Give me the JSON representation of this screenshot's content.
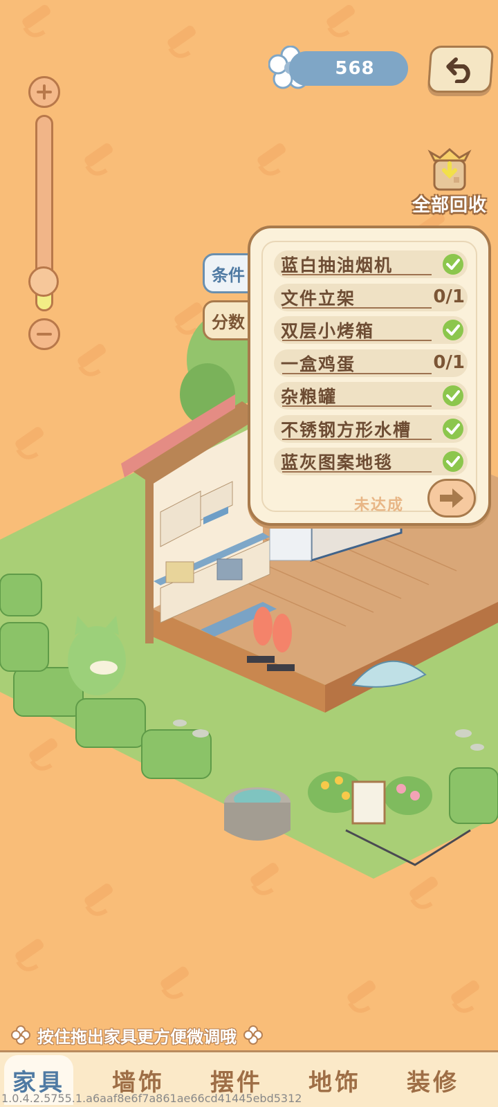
{
  "currency": {
    "icon": "flower-icon",
    "amount": "568"
  },
  "recycle_all": {
    "label": "全部回收",
    "icon": "recycle-bag-icon"
  },
  "zoom": {
    "level": 0.15
  },
  "side_tabs": [
    {
      "label": "条件",
      "active": true
    },
    {
      "label": "分数",
      "active": false
    }
  ],
  "conditions": [
    {
      "name": "蓝白抽油烟机",
      "done": true,
      "count": ""
    },
    {
      "name": "文件立架",
      "done": false,
      "count": "0/1"
    },
    {
      "name": "双层小烤箱",
      "done": true,
      "count": ""
    },
    {
      "name": "一盒鸡蛋",
      "done": false,
      "count": "0/1"
    },
    {
      "name": "杂粮罐",
      "done": true,
      "count": ""
    },
    {
      "name": "不锈钢方形水槽",
      "done": true,
      "count": ""
    },
    {
      "name": "蓝灰图案地毯",
      "done": true,
      "count": ""
    }
  ],
  "panel_status": "未达成",
  "hint": "按住拖出家具更方便微调哦",
  "bottom_tabs": [
    {
      "label": "家具",
      "active": true
    },
    {
      "label": "墙饰",
      "active": false
    },
    {
      "label": "摆件",
      "active": false
    },
    {
      "label": "地饰",
      "active": false
    },
    {
      "label": "装修",
      "active": false
    }
  ],
  "version": "1.0.4.2.5755.1.a6aaf8e6f7a861ae66cd41445ebd5312",
  "colors": {
    "background": "#f9bd78",
    "accent_blue": "#4f7aa3",
    "check_green": "#8cc64d",
    "wood": "#a87a4c"
  }
}
